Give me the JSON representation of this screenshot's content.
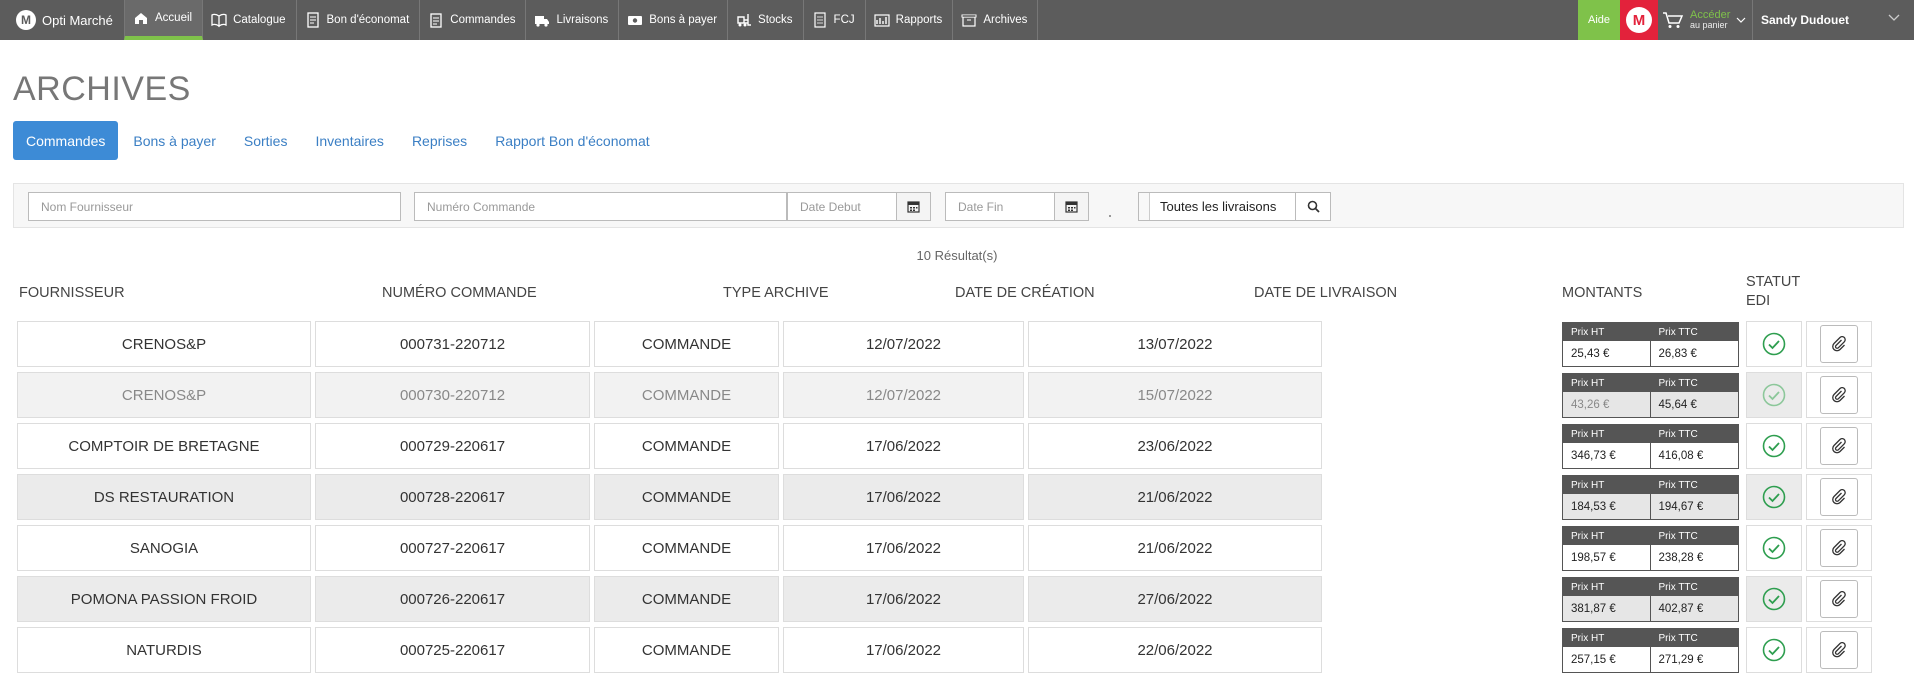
{
  "nav": {
    "logo": "Opti Marché",
    "items": [
      {
        "label": "Accueil",
        "icon": "home-icon",
        "active": true
      },
      {
        "label": "Catalogue",
        "icon": "book-icon"
      },
      {
        "label": "Bon d'économat",
        "icon": "document-icon"
      },
      {
        "label": "Commandes",
        "icon": "clipboard-icon"
      },
      {
        "label": "Livraisons",
        "icon": "truck-icon"
      },
      {
        "label": "Bons à payer",
        "icon": "cash-icon"
      },
      {
        "label": "Stocks",
        "icon": "forklift-icon"
      },
      {
        "label": "FCJ",
        "icon": "sheet-icon"
      },
      {
        "label": "Rapports",
        "icon": "chart-icon"
      },
      {
        "label": "Archives",
        "icon": "archive-icon"
      }
    ],
    "aide": "Aide",
    "brand_letter": "M",
    "cart_line1": "Accéder",
    "cart_line2": "au panier",
    "user_name": "Sandy Dudouet"
  },
  "page": {
    "title": "ARCHIVES",
    "tabs": [
      {
        "label": "Commandes",
        "active": true
      },
      {
        "label": "Bons à payer"
      },
      {
        "label": "Sorties"
      },
      {
        "label": "Inventaires"
      },
      {
        "label": "Reprises"
      },
      {
        "label": "Rapport Bon d'économat"
      }
    ]
  },
  "filters": {
    "fournisseur_placeholder": "Nom Fournisseur",
    "numero_placeholder": "Numéro Commande",
    "date_debut_placeholder": "Date Debut",
    "date_fin_placeholder": "Date Fin",
    "livraisons": "Toutes les livraisons"
  },
  "results": {
    "count": "10 Résultat(s)"
  },
  "table": {
    "headers": {
      "fournisseur": "Fournisseur",
      "numero": "Numéro Commande",
      "type": "Type Archive",
      "creation": "Date de création",
      "livraison": "Date de livraison",
      "montants": "Montants",
      "statut1": "Statut",
      "statut2": "EDI"
    },
    "price_ht_label": "Prix HT",
    "price_ttc_label": "Prix TTC",
    "rows": [
      {
        "fournisseur": "CRENOS&P",
        "numero": "000731-220712",
        "type": "COMMANDE",
        "creation": "12/07/2022",
        "livraison": "13/07/2022",
        "ht": "25,43 €",
        "ttc": "26,83 €",
        "style": "white"
      },
      {
        "fournisseur": "CRENOS&P",
        "numero": "000730-220712",
        "type": "COMMANDE",
        "creation": "12/07/2022",
        "livraison": "15/07/2022",
        "ht": "43,26 €",
        "ttc": "45,64 €",
        "style": "dim"
      },
      {
        "fournisseur": "COMPTOIR DE BRETAGNE",
        "numero": "000729-220617",
        "type": "COMMANDE",
        "creation": "17/06/2022",
        "livraison": "23/06/2022",
        "ht": "346,73 €",
        "ttc": "416,08 €",
        "style": "white"
      },
      {
        "fournisseur": "DS RESTAURATION",
        "numero": "000728-220617",
        "type": "COMMANDE",
        "creation": "17/06/2022",
        "livraison": "21/06/2022",
        "ht": "184,53 €",
        "ttc": "194,67 €",
        "style": "grey"
      },
      {
        "fournisseur": "SANOGIA",
        "numero": "000727-220617",
        "type": "COMMANDE",
        "creation": "17/06/2022",
        "livraison": "21/06/2022",
        "ht": "198,57 €",
        "ttc": "238,28 €",
        "style": "white"
      },
      {
        "fournisseur": "POMONA PASSION FROID",
        "numero": "000726-220617",
        "type": "COMMANDE",
        "creation": "17/06/2022",
        "livraison": "27/06/2022",
        "ht": "381,87 €",
        "ttc": "402,87 €",
        "style": "grey"
      },
      {
        "fournisseur": "NATURDIS",
        "numero": "000725-220617",
        "type": "COMMANDE",
        "creation": "17/06/2022",
        "livraison": "22/06/2022",
        "ht": "257,15 €",
        "ttc": "271,29 €",
        "style": "white"
      }
    ]
  },
  "colors": {
    "nav_bg": "#5c5c5c",
    "accent_green": "#7fc24a",
    "brand_red": "#e3223b",
    "tab_active": "#3d8bd6",
    "check_green": "#2e9e4f"
  }
}
